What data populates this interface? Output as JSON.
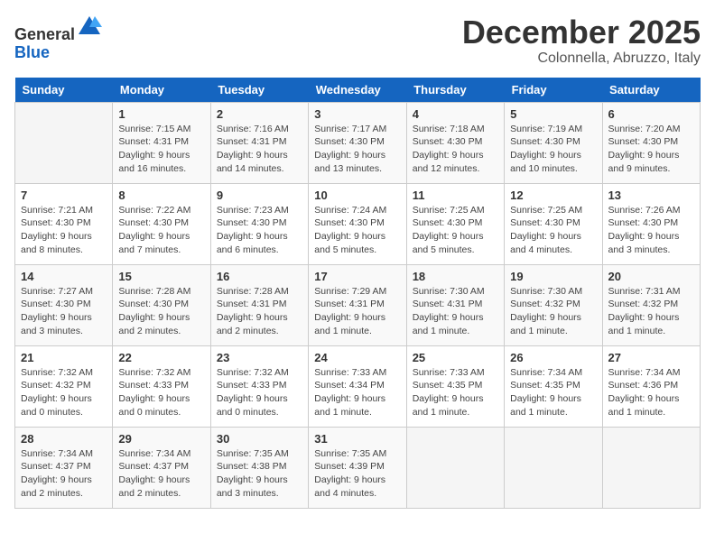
{
  "header": {
    "logo_line1": "General",
    "logo_line2": "Blue",
    "month_title": "December 2025",
    "location": "Colonnella, Abruzzo, Italy"
  },
  "calendar": {
    "days_of_week": [
      "Sunday",
      "Monday",
      "Tuesday",
      "Wednesday",
      "Thursday",
      "Friday",
      "Saturday"
    ],
    "weeks": [
      [
        {
          "num": "",
          "info": ""
        },
        {
          "num": "1",
          "info": "Sunrise: 7:15 AM\nSunset: 4:31 PM\nDaylight: 9 hours\nand 16 minutes."
        },
        {
          "num": "2",
          "info": "Sunrise: 7:16 AM\nSunset: 4:31 PM\nDaylight: 9 hours\nand 14 minutes."
        },
        {
          "num": "3",
          "info": "Sunrise: 7:17 AM\nSunset: 4:30 PM\nDaylight: 9 hours\nand 13 minutes."
        },
        {
          "num": "4",
          "info": "Sunrise: 7:18 AM\nSunset: 4:30 PM\nDaylight: 9 hours\nand 12 minutes."
        },
        {
          "num": "5",
          "info": "Sunrise: 7:19 AM\nSunset: 4:30 PM\nDaylight: 9 hours\nand 10 minutes."
        },
        {
          "num": "6",
          "info": "Sunrise: 7:20 AM\nSunset: 4:30 PM\nDaylight: 9 hours\nand 9 minutes."
        }
      ],
      [
        {
          "num": "7",
          "info": "Sunrise: 7:21 AM\nSunset: 4:30 PM\nDaylight: 9 hours\nand 8 minutes."
        },
        {
          "num": "8",
          "info": "Sunrise: 7:22 AM\nSunset: 4:30 PM\nDaylight: 9 hours\nand 7 minutes."
        },
        {
          "num": "9",
          "info": "Sunrise: 7:23 AM\nSunset: 4:30 PM\nDaylight: 9 hours\nand 6 minutes."
        },
        {
          "num": "10",
          "info": "Sunrise: 7:24 AM\nSunset: 4:30 PM\nDaylight: 9 hours\nand 5 minutes."
        },
        {
          "num": "11",
          "info": "Sunrise: 7:25 AM\nSunset: 4:30 PM\nDaylight: 9 hours\nand 5 minutes."
        },
        {
          "num": "12",
          "info": "Sunrise: 7:25 AM\nSunset: 4:30 PM\nDaylight: 9 hours\nand 4 minutes."
        },
        {
          "num": "13",
          "info": "Sunrise: 7:26 AM\nSunset: 4:30 PM\nDaylight: 9 hours\nand 3 minutes."
        }
      ],
      [
        {
          "num": "14",
          "info": "Sunrise: 7:27 AM\nSunset: 4:30 PM\nDaylight: 9 hours\nand 3 minutes."
        },
        {
          "num": "15",
          "info": "Sunrise: 7:28 AM\nSunset: 4:30 PM\nDaylight: 9 hours\nand 2 minutes."
        },
        {
          "num": "16",
          "info": "Sunrise: 7:28 AM\nSunset: 4:31 PM\nDaylight: 9 hours\nand 2 minutes."
        },
        {
          "num": "17",
          "info": "Sunrise: 7:29 AM\nSunset: 4:31 PM\nDaylight: 9 hours\nand 1 minute."
        },
        {
          "num": "18",
          "info": "Sunrise: 7:30 AM\nSunset: 4:31 PM\nDaylight: 9 hours\nand 1 minute."
        },
        {
          "num": "19",
          "info": "Sunrise: 7:30 AM\nSunset: 4:32 PM\nDaylight: 9 hours\nand 1 minute."
        },
        {
          "num": "20",
          "info": "Sunrise: 7:31 AM\nSunset: 4:32 PM\nDaylight: 9 hours\nand 1 minute."
        }
      ],
      [
        {
          "num": "21",
          "info": "Sunrise: 7:32 AM\nSunset: 4:32 PM\nDaylight: 9 hours\nand 0 minutes."
        },
        {
          "num": "22",
          "info": "Sunrise: 7:32 AM\nSunset: 4:33 PM\nDaylight: 9 hours\nand 0 minutes."
        },
        {
          "num": "23",
          "info": "Sunrise: 7:32 AM\nSunset: 4:33 PM\nDaylight: 9 hours\nand 0 minutes."
        },
        {
          "num": "24",
          "info": "Sunrise: 7:33 AM\nSunset: 4:34 PM\nDaylight: 9 hours\nand 1 minute."
        },
        {
          "num": "25",
          "info": "Sunrise: 7:33 AM\nSunset: 4:35 PM\nDaylight: 9 hours\nand 1 minute."
        },
        {
          "num": "26",
          "info": "Sunrise: 7:34 AM\nSunset: 4:35 PM\nDaylight: 9 hours\nand 1 minute."
        },
        {
          "num": "27",
          "info": "Sunrise: 7:34 AM\nSunset: 4:36 PM\nDaylight: 9 hours\nand 1 minute."
        }
      ],
      [
        {
          "num": "28",
          "info": "Sunrise: 7:34 AM\nSunset: 4:37 PM\nDaylight: 9 hours\nand 2 minutes."
        },
        {
          "num": "29",
          "info": "Sunrise: 7:34 AM\nSunset: 4:37 PM\nDaylight: 9 hours\nand 2 minutes."
        },
        {
          "num": "30",
          "info": "Sunrise: 7:35 AM\nSunset: 4:38 PM\nDaylight: 9 hours\nand 3 minutes."
        },
        {
          "num": "31",
          "info": "Sunrise: 7:35 AM\nSunset: 4:39 PM\nDaylight: 9 hours\nand 4 minutes."
        },
        {
          "num": "",
          "info": ""
        },
        {
          "num": "",
          "info": ""
        },
        {
          "num": "",
          "info": ""
        }
      ]
    ]
  }
}
